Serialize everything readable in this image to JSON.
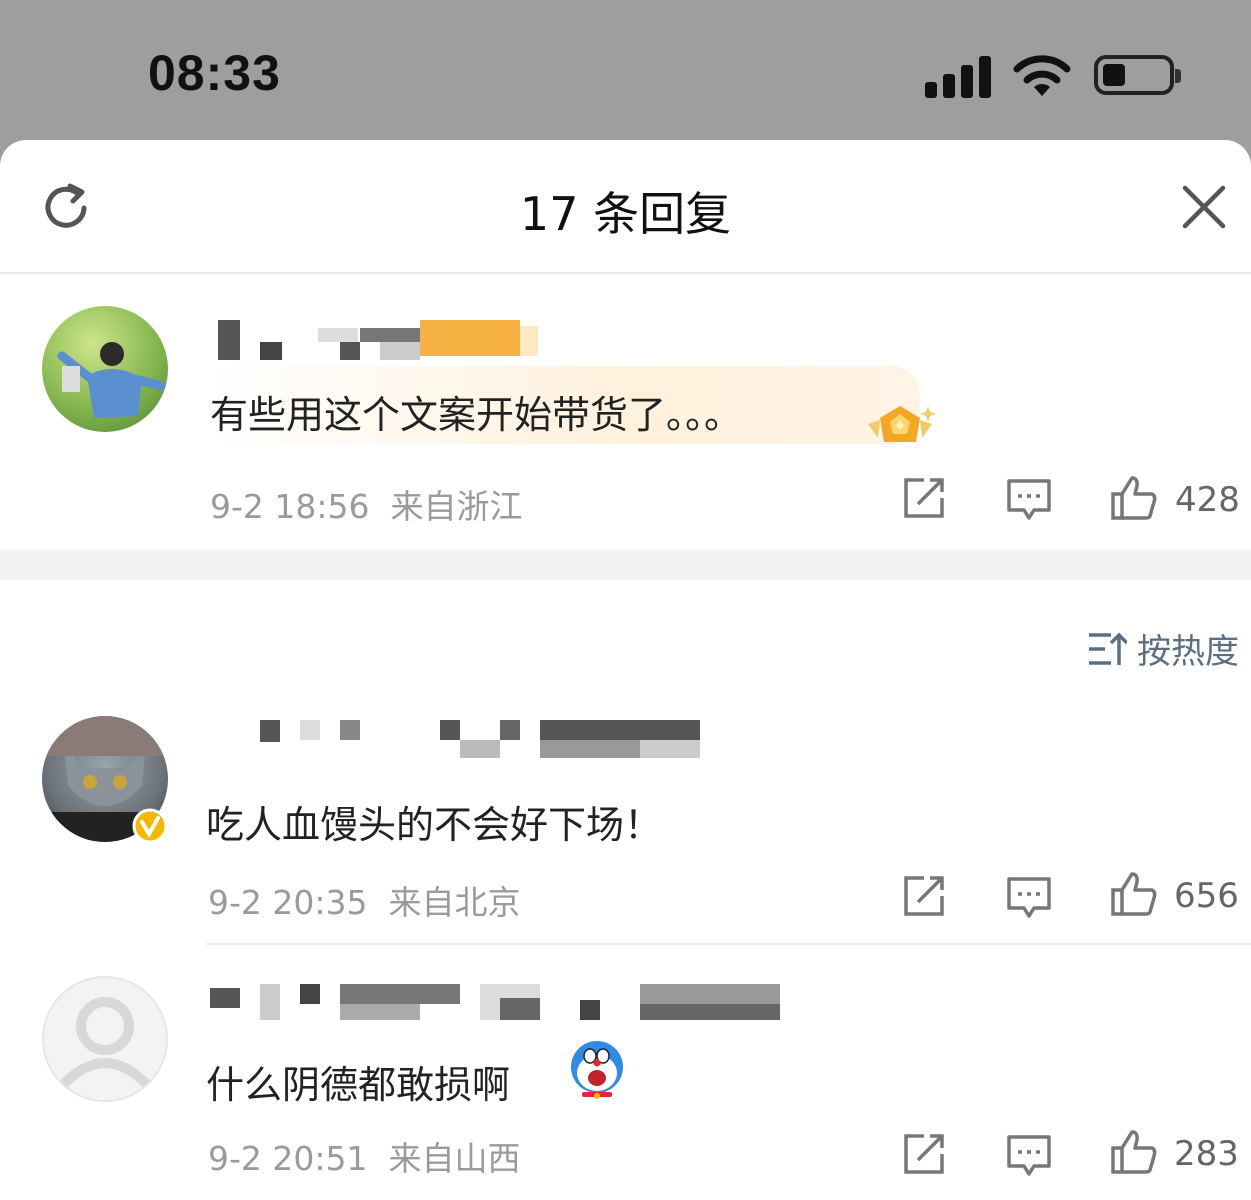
{
  "status_bar": {
    "time": "08:33"
  },
  "sheet": {
    "title": "17 条回复"
  },
  "root_comment": {
    "text": "有些用这个文案开始带货了。。。",
    "time": "9-2 18:56",
    "location": "来自浙江",
    "likes": "428"
  },
  "sort": {
    "label": "按热度"
  },
  "replies": [
    {
      "text": "吃人血馒头的不会好下场！",
      "time": "9-2 20:35",
      "location": "来自北京",
      "likes": "656"
    },
    {
      "text": "什么阴德都敢损啊",
      "time": "9-2 20:51",
      "location": "来自山西",
      "likes": "283"
    }
  ],
  "icons": [
    "refresh-icon",
    "close-icon",
    "share-icon",
    "comment-icon",
    "like-icon",
    "sort-icon",
    "verified-badge-icon",
    "crown-badge-icon",
    "doraemon-emoji-icon"
  ],
  "colors": {
    "accent_sort": "#5a6f86",
    "meta_gray": "#9a9a9a",
    "verified": "#f5b800"
  }
}
